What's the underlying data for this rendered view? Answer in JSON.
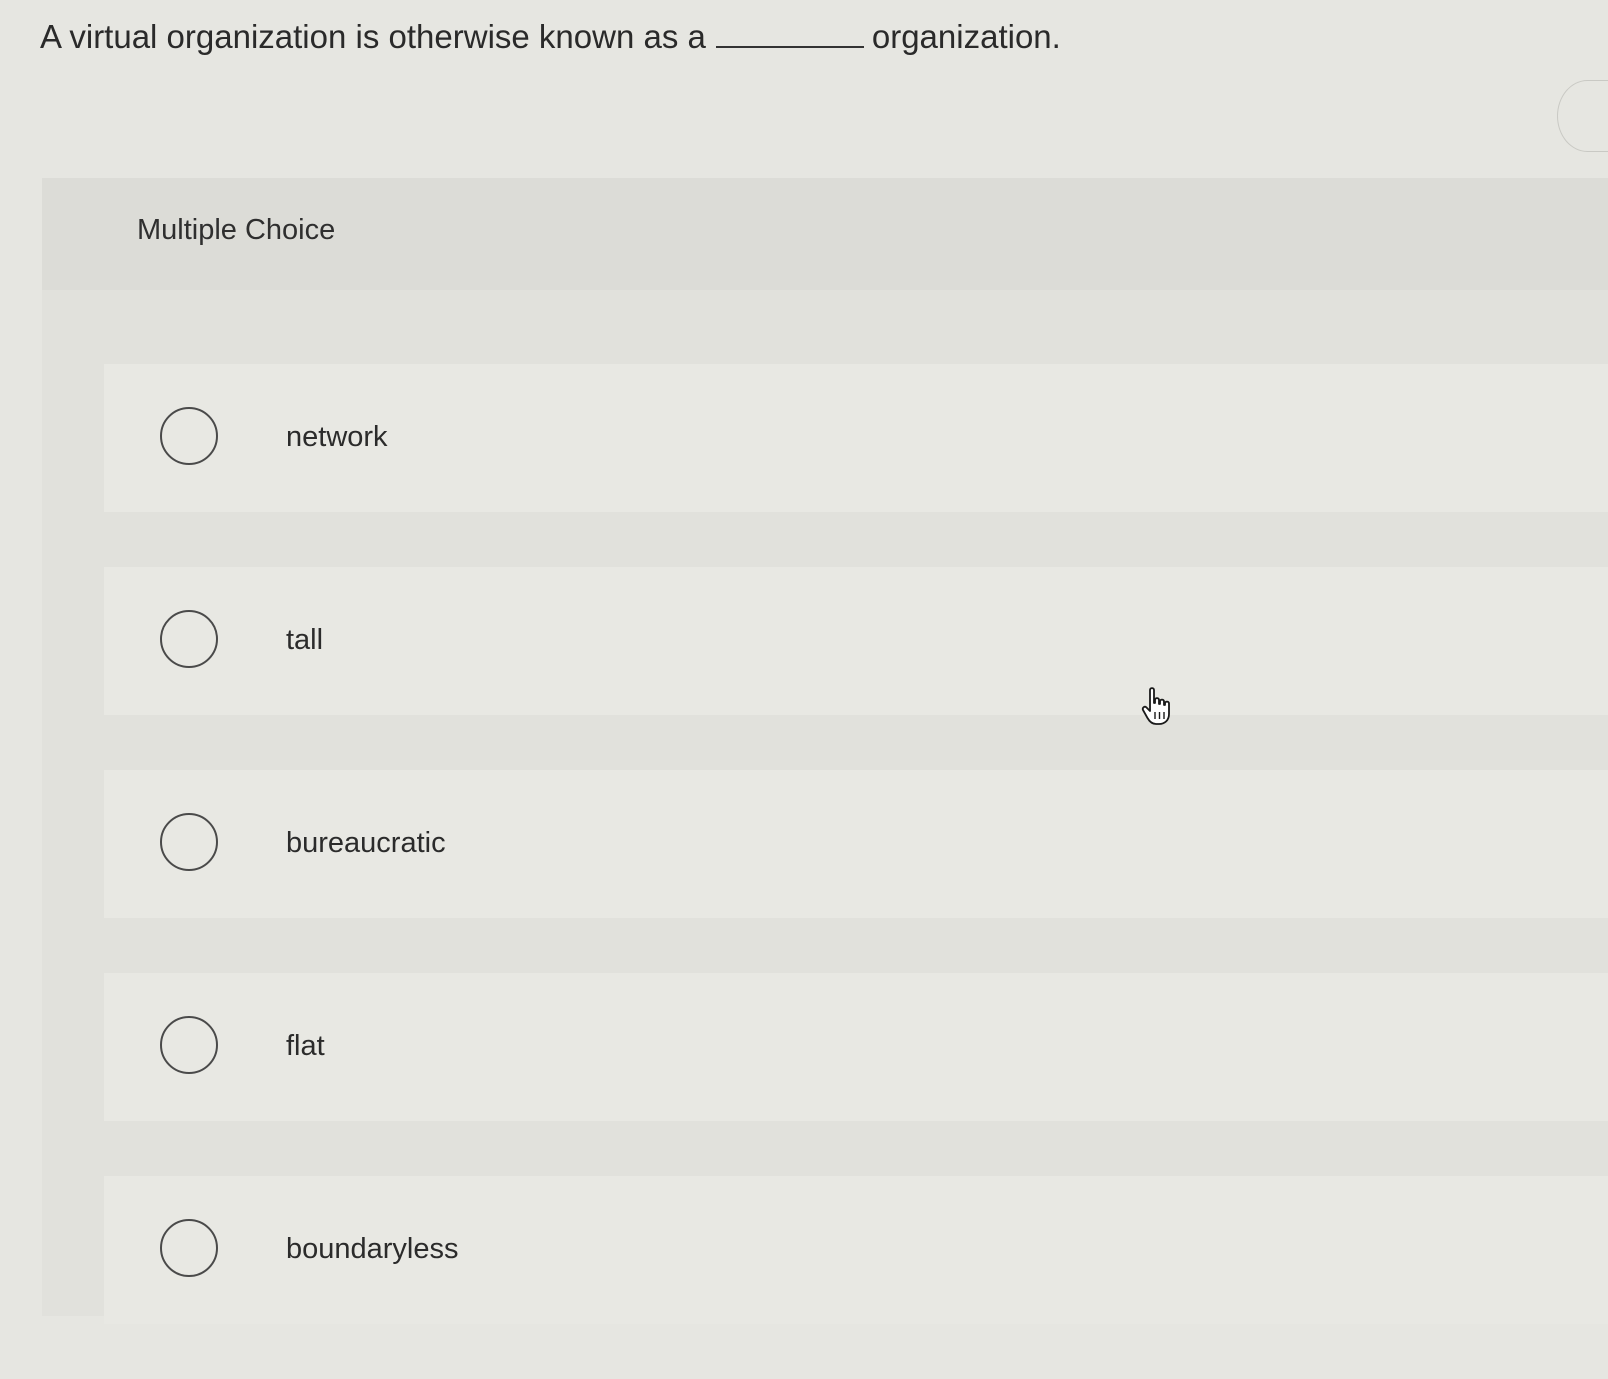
{
  "question": {
    "prefix": "A virtual organization is otherwise known as a",
    "suffix": "organization."
  },
  "panel": {
    "title": "Multiple Choice"
  },
  "choices": [
    {
      "label": "network",
      "selected": false
    },
    {
      "label": "tall",
      "selected": false
    },
    {
      "label": "bureaucratic",
      "selected": false
    },
    {
      "label": "flat",
      "selected": false
    },
    {
      "label": "boundaryless",
      "selected": false
    }
  ],
  "cursor": {
    "icon": "hand-pointer-icon"
  }
}
